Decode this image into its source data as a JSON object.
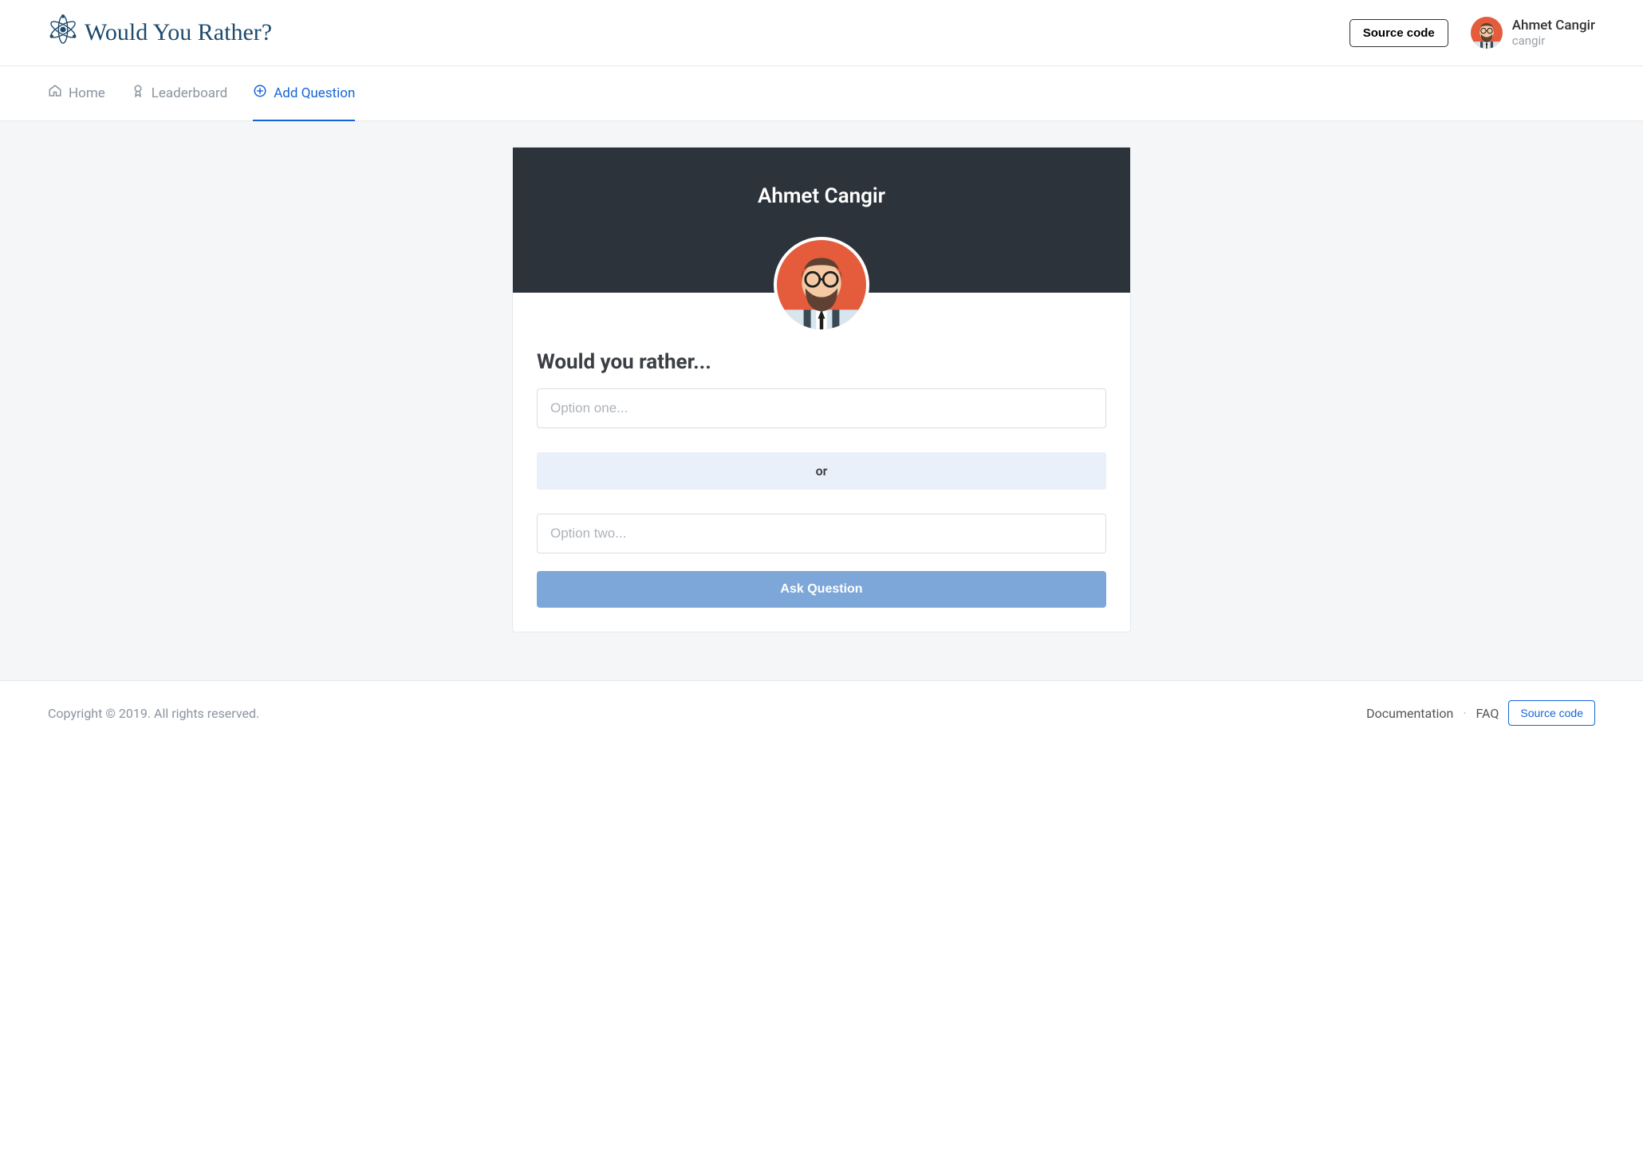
{
  "brand": {
    "title": "Would You Rather?"
  },
  "header": {
    "source_code_label": "Source code",
    "user": {
      "name": "Ahmet Cangir",
      "handle": "cangir"
    }
  },
  "nav": {
    "home": "Home",
    "leaderboard": "Leaderboard",
    "add_question": "Add Question"
  },
  "card": {
    "author": "Ahmet Cangir",
    "prompt": "Would you rather...",
    "option_one_placeholder": "Option one...",
    "separator": "or",
    "option_two_placeholder": "Option two...",
    "submit_label": "Ask Question"
  },
  "footer": {
    "copyright": "Copyright © 2019. All rights reserved.",
    "documentation": "Documentation",
    "faq": "FAQ",
    "source_code": "Source code"
  },
  "colors": {
    "accent": "#1665d8",
    "header_dark": "#2d333a",
    "avatar_bg": "#e55c3c"
  }
}
